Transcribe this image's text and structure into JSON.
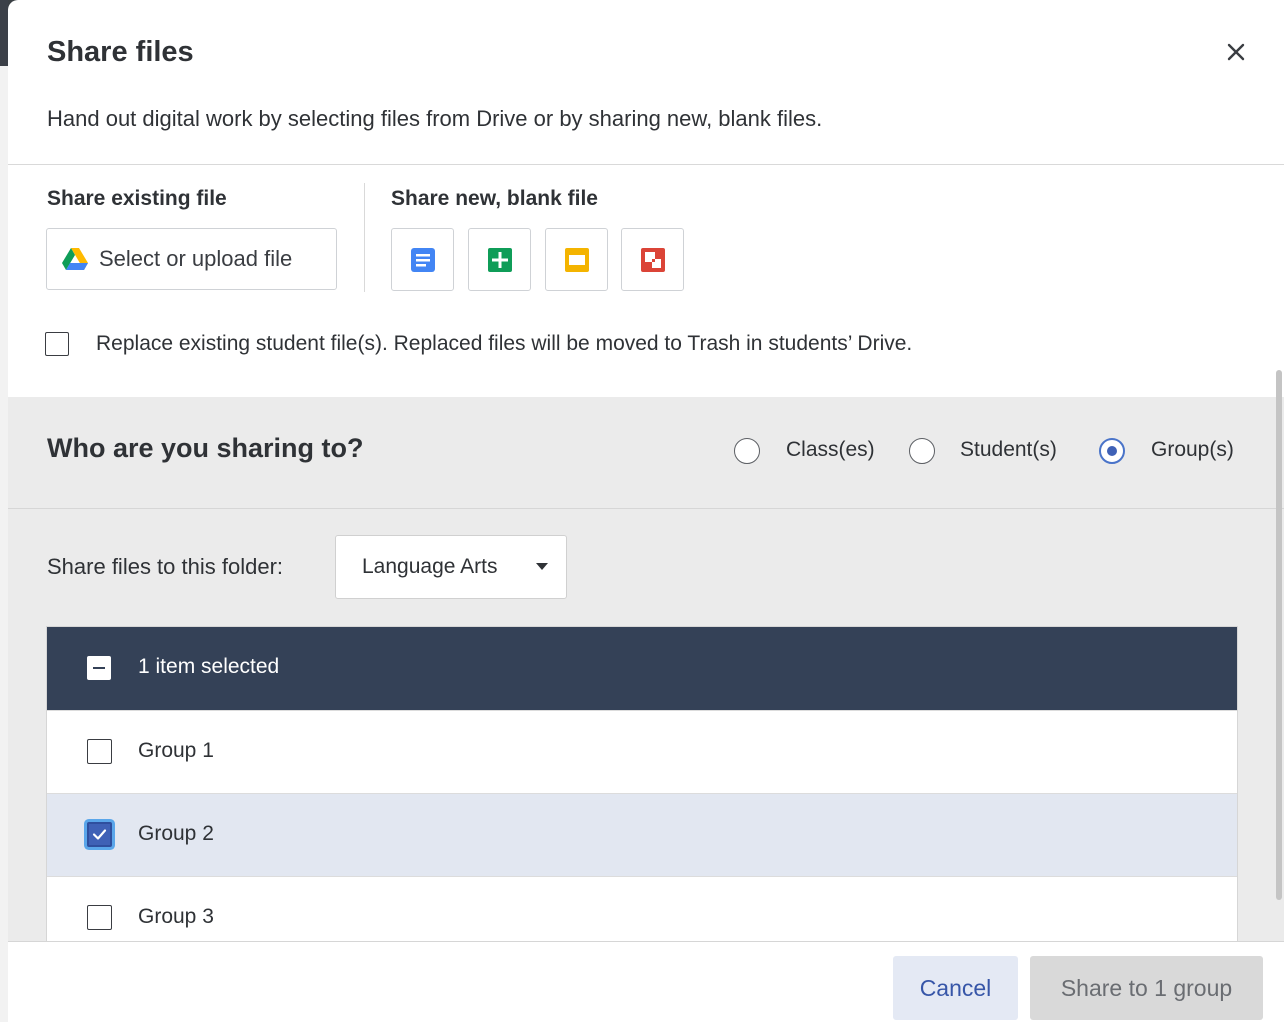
{
  "dialog": {
    "title": "Share files",
    "subtitle": "Hand out digital work by selecting files from Drive or by sharing new, blank files."
  },
  "share_existing": {
    "label": "Share existing file",
    "button_label": "Select or upload file",
    "button_icon": "google-drive-icon"
  },
  "share_new": {
    "label": "Share new, blank file",
    "tiles": [
      {
        "icon": "google-docs-icon",
        "color": "#4285f4"
      },
      {
        "icon": "google-sheets-icon",
        "color": "#0f9d58"
      },
      {
        "icon": "google-slides-icon",
        "color": "#f4b400"
      },
      {
        "icon": "google-drawings-icon",
        "color": "#db4437"
      }
    ]
  },
  "replace": {
    "checked": false,
    "label": "Replace existing student file(s). Replaced files will be moved to Trash in students’ Drive."
  },
  "who": {
    "title": "Who are you sharing to?",
    "options": [
      {
        "label": "Class(es)",
        "selected": false
      },
      {
        "label": "Student(s)",
        "selected": false
      },
      {
        "label": "Group(s)",
        "selected": true
      }
    ]
  },
  "folder": {
    "label": "Share files to this folder:",
    "selected": "Language Arts"
  },
  "table": {
    "header": "1 item selected",
    "rows": [
      {
        "label": "Group 1",
        "checked": false
      },
      {
        "label": "Group 2",
        "checked": true
      },
      {
        "label": "Group 3",
        "checked": false
      }
    ]
  },
  "footer": {
    "cancel_label": "Cancel",
    "share_label": "Share to 1 group"
  },
  "colors": {
    "accent": "#3f61b6",
    "table_header": "#344157",
    "selected_row": "#e2e7f1"
  }
}
